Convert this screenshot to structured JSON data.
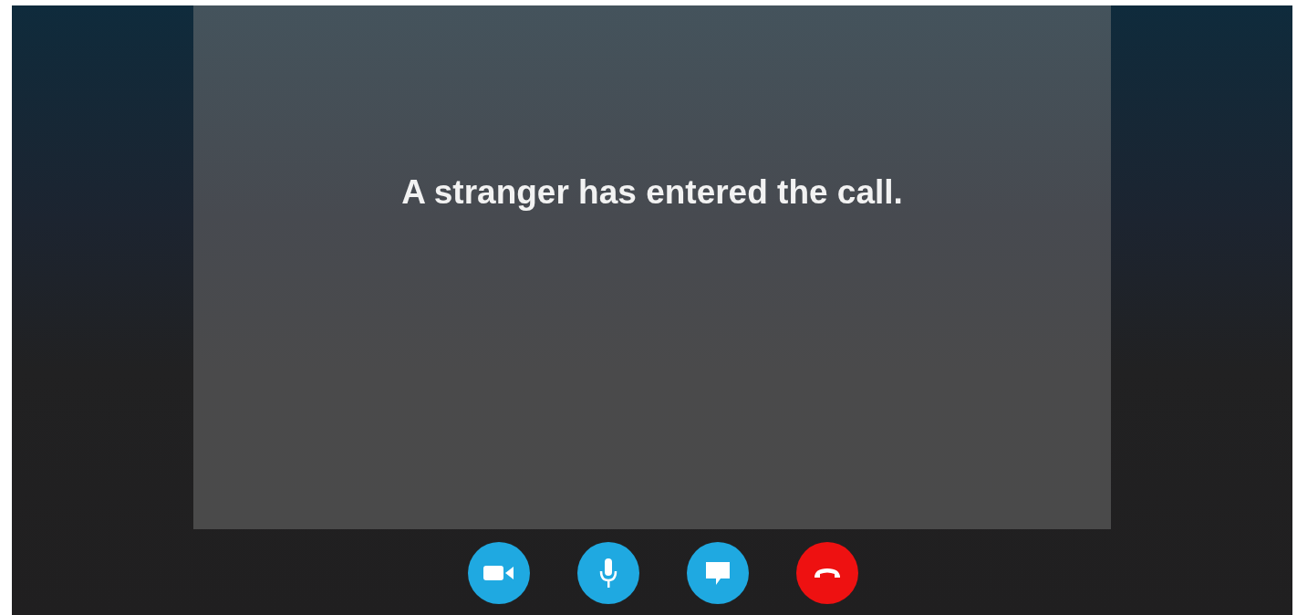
{
  "message": "A stranger has entered the call.",
  "controls": [
    {
      "kind": "video"
    },
    {
      "kind": "microphone"
    },
    {
      "kind": "chat"
    },
    {
      "kind": "hangup"
    }
  ]
}
